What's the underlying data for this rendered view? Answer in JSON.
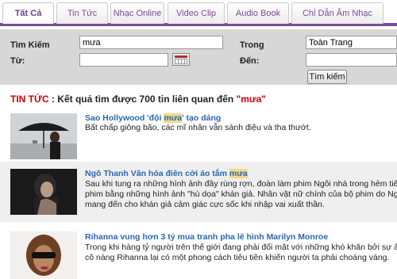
{
  "tabs": [
    {
      "label": "Tất Cả",
      "active": true
    },
    {
      "label": "Tin Tức",
      "active": false
    },
    {
      "label": "Nhạc Online",
      "active": false
    },
    {
      "label": "Video Clip",
      "active": false
    },
    {
      "label": "Audio Book",
      "active": false
    },
    {
      "label": "Chỉ Dẫn Âm Nhạc",
      "active": false
    }
  ],
  "search": {
    "keyword_label": "Tìm Kiếm",
    "keyword_value": "mưa",
    "in_label": "Trong",
    "in_value": "Toàn Trang",
    "from_label": "Từ:",
    "from_value": "",
    "to_label": "Đến:",
    "to_value": "",
    "button_label": "Tìm kiếm"
  },
  "results_header": {
    "category": "TIN TỨC",
    "text": " : Kết quả tìm được 700 tin liên quan đến ",
    "keyword": "\"mưa\""
  },
  "results": [
    {
      "title_before": "Sao Hollywood 'đội ",
      "title_highlight": "mưa",
      "title_after": "' tạo dáng",
      "desc_lines": [
        "Bất chấp giông bão, các mĩ nhân vẫn sành điệu và tha thướt."
      ]
    },
    {
      "title_before": "Ngô Thanh Vân hóa điên cởi áo tắm ",
      "title_highlight": "mưa",
      "title_after": "",
      "desc_lines": [
        "Sau khi tung ra những hình ảnh đầy rùng rợn, đoàn làm phim Ngôi nhà trong hẻm tiếp tục hé lộ c",
        "phim bằng những hình ảnh \"hù dọa\" khán giả. Nhân vật nữ chính của bộ phim do Ngô Thanh Vân đ",
        "mang đến cho khán giả cảm giác cực sốc khi nhập vai xuất thần."
      ]
    },
    {
      "title_before": "Rihanna vung hơn 3 tỷ mua tranh pha lê hình Marilyn Monroe",
      "title_highlight": "",
      "title_after": "",
      "desc_lines": [
        "Trong khi hàng tỷ người trên thế giới đang phải đối mặt với những khó khăn bởi sự ảm đạm của nền l",
        "cô nàng Rihanna lại có một phong cách tiêu tiền khiến người ta phải choáng váng."
      ]
    }
  ],
  "colors": {
    "accent": "#7a4a9c",
    "link": "#2a67b1",
    "category": "#cc0000",
    "highlight": "#f3d98a",
    "panel": "#d7d7d7"
  }
}
